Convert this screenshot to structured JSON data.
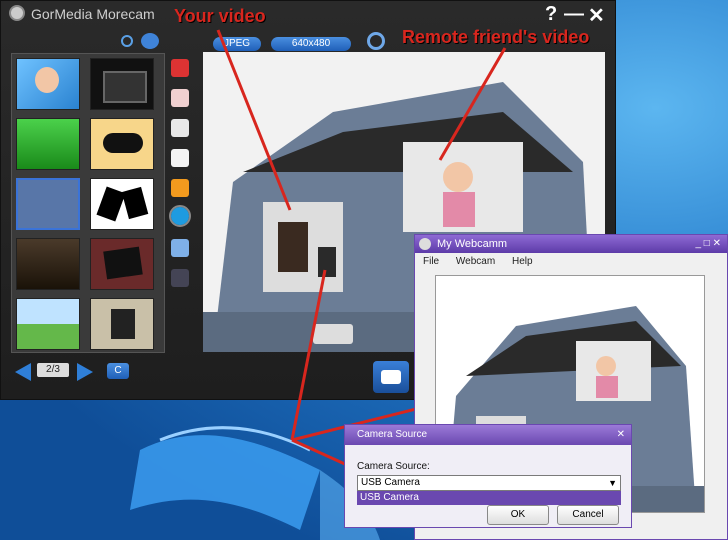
{
  "app": {
    "title": "GorMedia Morecam",
    "help": "?",
    "minimize": "—",
    "close": "✕",
    "format": "JPEG",
    "resolution": "640x480",
    "pager": "2/3",
    "c_button": "C"
  },
  "callouts": {
    "your_video": "Your video",
    "remote_video": "Remote friend's video"
  },
  "webcam": {
    "title": "My Webcamm",
    "menu": [
      "File",
      "Webcam",
      "Help"
    ]
  },
  "camera_source": {
    "title": "Camera Source",
    "label": "Camera Source:",
    "selected": "USB Camera",
    "option": "USB Camera",
    "ok": "OK",
    "cancel": "Cancel"
  },
  "colors": {
    "callout": "#d8261e",
    "accent": "#6a48b0"
  }
}
